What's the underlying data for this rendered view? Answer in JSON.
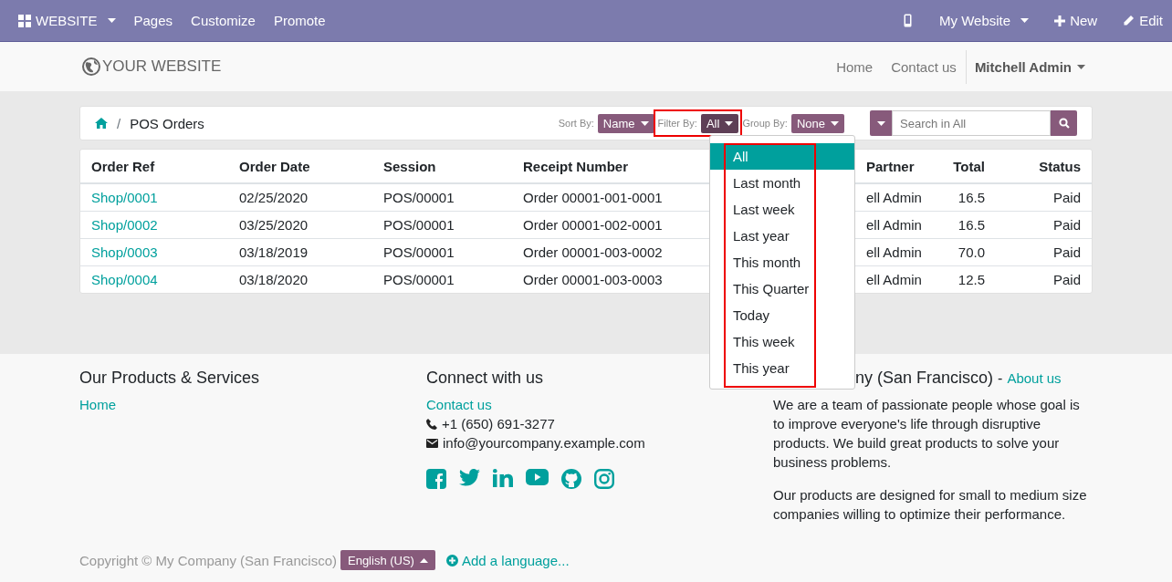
{
  "top_bar": {
    "app_menu": "WEBSITE",
    "left_items": [
      "Pages",
      "Customize",
      "Promote"
    ],
    "website_menu": "My Website",
    "new_button": "New",
    "edit_button": "Edit"
  },
  "header": {
    "logo": "YOUR WEBSITE",
    "nav": [
      "Home",
      "Contact us"
    ],
    "user_menu": "Mitchell Admin"
  },
  "breadcrumb": {
    "current": "POS Orders",
    "separator": "/"
  },
  "controls": [
    {
      "label": "Sort By:",
      "value": "Name",
      "open": false
    },
    {
      "label": "Filter By:",
      "value": "All",
      "open": true
    },
    {
      "label": "Group By:",
      "value": "None",
      "open": false
    }
  ],
  "search": {
    "placeholder": "Search in All"
  },
  "filter_menu": [
    {
      "label": "All",
      "selected": true
    },
    {
      "label": "Last month",
      "selected": false
    },
    {
      "label": "Last week",
      "selected": false
    },
    {
      "label": "Last year",
      "selected": false
    },
    {
      "label": "This month",
      "selected": false
    },
    {
      "label": "This Quarter",
      "selected": false
    },
    {
      "label": "Today",
      "selected": false
    },
    {
      "label": "This week",
      "selected": false
    },
    {
      "label": "This year",
      "selected": false
    }
  ],
  "table": {
    "columns": [
      "Order Ref",
      "Order Date",
      "Session",
      "Receipt Number",
      "Partner",
      "Total",
      "Status"
    ],
    "rows": [
      [
        "Shop/0001",
        "02/25/2020",
        "POS/00001",
        "Order 00001-001-0001",
        "ell Admin",
        "16.5",
        "Paid"
      ],
      [
        "Shop/0002",
        "03/25/2020",
        "POS/00001",
        "Order 00001-002-0001",
        "ell Admin",
        "16.5",
        "Paid"
      ],
      [
        "Shop/0003",
        "03/18/2019",
        "POS/00001",
        "Order 00001-003-0002",
        "ell Admin",
        "70.0",
        "Paid"
      ],
      [
        "Shop/0004",
        "03/18/2020",
        "POS/00001",
        "Order 00001-003-0003",
        "ell Admin",
        "12.5",
        "Paid"
      ]
    ]
  },
  "footer": {
    "products": {
      "title": "Our Products & Services",
      "links": [
        "Home"
      ]
    },
    "connect": {
      "title": "Connect with us",
      "link": "Contact us",
      "phone": "+1 (650) 691-3277",
      "email": "info@yourcompany.example.com"
    },
    "about": {
      "title": "ny (San Francisco)",
      "separator": "-",
      "link": "About us",
      "paragraphs": [
        "We are a team of passionate people whose goal is to improve everyone's life through disruptive products. We build great products to solve your business problems.",
        "Our products are designed for small to medium size companies willing to optimize their performance."
      ]
    },
    "copyright": "Copyright © My Company (San Francisco)",
    "language": "English (US)",
    "add_language": "Add a language..."
  }
}
